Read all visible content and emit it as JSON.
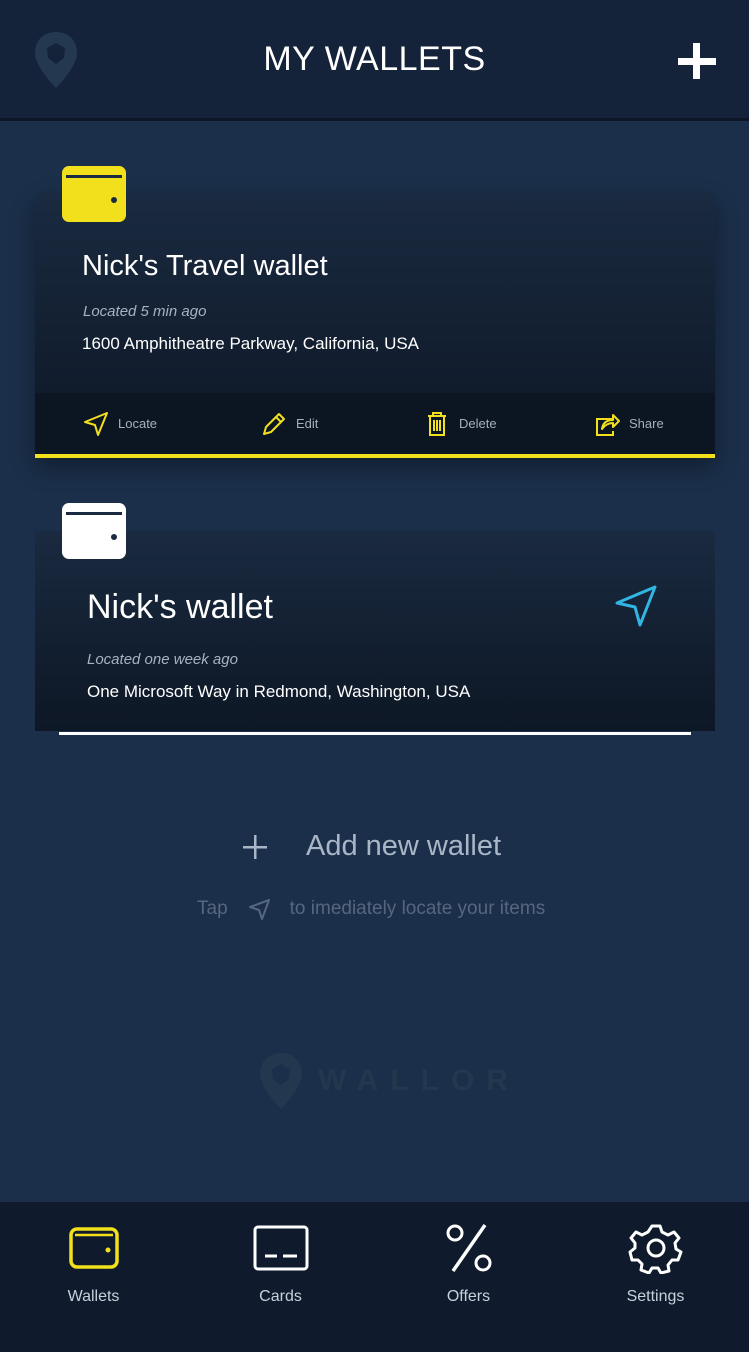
{
  "header": {
    "title": "MY WALLETS"
  },
  "wallets": [
    {
      "name": "Nick's Travel wallet",
      "located": "Located 5 min ago",
      "address": "1600 Amphitheatre Parkway, California, USA",
      "color": "#f2e01d",
      "actions": {
        "locate": "Locate",
        "edit": "Edit",
        "delete": "Delete",
        "share": "Share"
      }
    },
    {
      "name": "Nick's wallet",
      "located": "Located one week ago",
      "address": "One Microsoft Way in Redmond, Washington, USA",
      "color": "#ffffff"
    }
  ],
  "add_new": "Add new wallet",
  "hint": {
    "before": "Tap",
    "after": "to imediately locate your items"
  },
  "watermark": "WALLOR",
  "tabs": {
    "wallets": "Wallets",
    "cards": "Cards",
    "offers": "Offers",
    "settings": "Settings"
  },
  "colors": {
    "accent": "#f2e01d",
    "locate_icon": "#31b6e3",
    "background": "#1b2f4a"
  }
}
